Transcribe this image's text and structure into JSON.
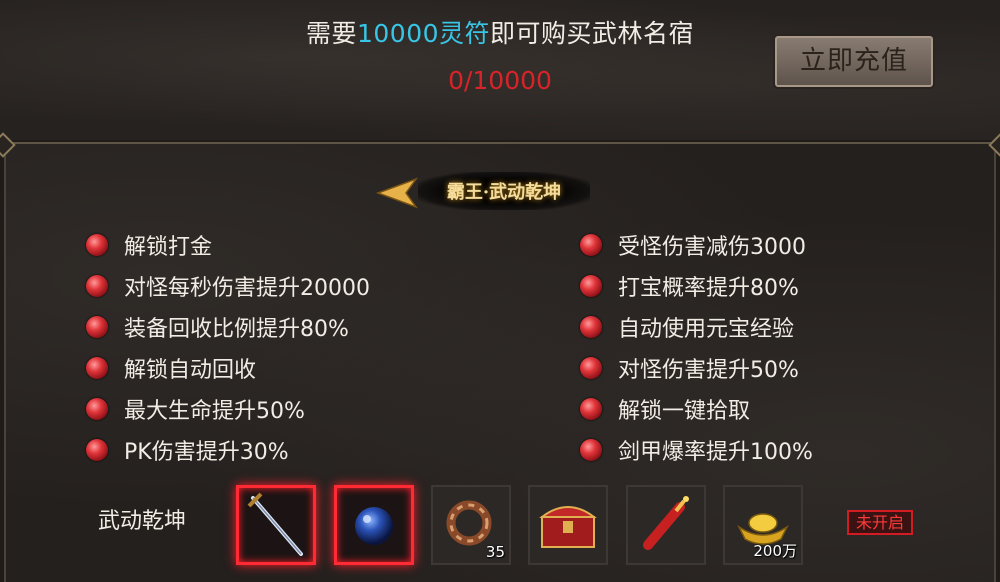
{
  "header": {
    "requirement_prefix": "需要",
    "requirement_amount": "10000灵符",
    "requirement_suffix": "即可购买武林名宿",
    "progress": "0/10000",
    "recharge_label": "立即充值"
  },
  "tier": {
    "title": "霸王·武动乾坤"
  },
  "benefits_left": [
    "解锁打金",
    "对怪每秒伤害提升20000",
    "装备回收比例提升80%",
    "解锁自动回收",
    "最大生命提升50%",
    "PK伤害提升30%"
  ],
  "benefits_right": [
    "受怪伤害减伤3000",
    "打宝概率提升80%",
    "自动使用元宝经验",
    "对怪伤害提升50%",
    "解锁一键拾取",
    "剑甲爆率提升100%"
  ],
  "rewards": {
    "label": "武动乾坤",
    "items": [
      {
        "icon": "sword-icon",
        "count": ""
      },
      {
        "icon": "blue-orb-icon",
        "count": ""
      },
      {
        "icon": "ring-icon",
        "count": "35"
      },
      {
        "icon": "treasure-chest-icon",
        "count": ""
      },
      {
        "icon": "firecracker-icon",
        "count": ""
      },
      {
        "icon": "gold-ingot-icon",
        "count": "200万"
      }
    ],
    "status": "未开启"
  },
  "colors": {
    "highlight": "#38c5e6",
    "progress": "#d8232a",
    "accent_red": "#ff2b34"
  }
}
